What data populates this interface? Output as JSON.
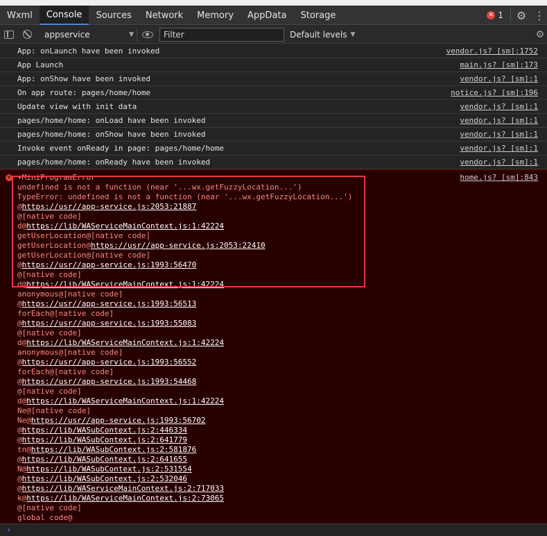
{
  "tabs": [
    {
      "label": "Wxml",
      "active": false
    },
    {
      "label": "Console",
      "active": true
    },
    {
      "label": "Sources",
      "active": false
    },
    {
      "label": "Network",
      "active": false
    },
    {
      "label": "Memory",
      "active": false
    },
    {
      "label": "AppData",
      "active": false
    },
    {
      "label": "Storage",
      "active": false
    }
  ],
  "error_count": "1",
  "toolbar": {
    "context": "appservice",
    "filter_placeholder": "Filter",
    "levels": "Default levels"
  },
  "logs": [
    {
      "text": "App: onLaunch have been invoked",
      "source": "vendor.js? [sm]:1752"
    },
    {
      "text": "App Launch",
      "source": "main.js? [sm]:173"
    },
    {
      "text": "App: onShow have been invoked",
      "source": "vendor.js? [sm]:1"
    },
    {
      "text": "On app route: pages/home/home",
      "source": "notice.js? [sm]:196"
    },
    {
      "text": "Update view with init data",
      "source": "vendor.js? [sm]:1"
    },
    {
      "text": "pages/home/home: onLoad have been invoked",
      "source": "vendor.js? [sm]:1"
    },
    {
      "text": "pages/home/home: onShow have been invoked",
      "source": "vendor.js? [sm]:1"
    },
    {
      "text": "Invoke event onReady in page: pages/home/home",
      "source": "vendor.js? [sm]:1"
    },
    {
      "text": "pages/home/home: onReady have been invoked",
      "source": "vendor.js? [sm]:1"
    }
  ],
  "error": {
    "source": "home.js? [sm]:843",
    "header": "▾MiniProgramError",
    "lines": [
      {
        "fn": "undefined is not a function (near '...wx.getFuzzyLocation...')",
        "url": ""
      },
      {
        "fn": "TypeError: undefined is not a function (near '...wx.getFuzzyLocation...')",
        "url": ""
      },
      {
        "fn": "@",
        "url": "https://usr//app-service.js:2053:21887"
      },
      {
        "fn": "@[native code]",
        "url": ""
      },
      {
        "fn": "d@",
        "url": "https://lib/WAServiceMainContext.js:1:42224"
      },
      {
        "fn": "getUserLocation@[native code]",
        "url": ""
      },
      {
        "fn": "getUserLocation@",
        "url": "https://usr//app-service.js:2053:22410"
      },
      {
        "fn": "getUserLocation@[native code]",
        "url": ""
      },
      {
        "fn": "@",
        "url": "https://usr//app-service.js:1993:56470"
      },
      {
        "fn": "@[native code]",
        "url": ""
      },
      {
        "fn": "d@",
        "url": "https://lib/WAServiceMainContext.js:1:42224"
      },
      {
        "fn": "anonymous@[native code]",
        "url": ""
      },
      {
        "fn": "@",
        "url": "https://usr//app-service.js:1993:56513"
      },
      {
        "fn": "forEach@[native code]",
        "url": ""
      },
      {
        "fn": "@",
        "url": "https://usr//app-service.js:1993:55083"
      },
      {
        "fn": "@[native code]",
        "url": ""
      },
      {
        "fn": "d@",
        "url": "https://lib/WAServiceMainContext.js:1:42224"
      },
      {
        "fn": "anonymous@[native code]",
        "url": ""
      },
      {
        "fn": "@",
        "url": "https://usr//app-service.js:1993:56552"
      },
      {
        "fn": "forEach@[native code]",
        "url": ""
      },
      {
        "fn": "@",
        "url": "https://usr//app-service.js:1993:54468"
      },
      {
        "fn": "@[native code]",
        "url": ""
      },
      {
        "fn": "d@",
        "url": "https://lib/WAServiceMainContext.js:1:42224"
      },
      {
        "fn": "Ne@[native code]",
        "url": ""
      },
      {
        "fn": "Ne@",
        "url": "https://usr//app-service.js:1993:56702"
      },
      {
        "fn": "@",
        "url": "https://lib/WASubContext.js:2:446334"
      },
      {
        "fn": "@",
        "url": "https://lib/WASubContext.js:2:641779"
      },
      {
        "fn": "tn@",
        "url": "https://lib/WASubContext.js:2:581876"
      },
      {
        "fn": "@",
        "url": "https://lib/WASubContext.js:2:641655"
      },
      {
        "fn": "N@",
        "url": "https://lib/WASubContext.js:2:531554"
      },
      {
        "fn": "@",
        "url": "https://lib/WASubContext.js:2:532046"
      },
      {
        "fn": "@",
        "url": "https://lib/WAServiceMainContext.js:2:717033"
      },
      {
        "fn": "k@",
        "url": "https://lib/WAServiceMainContext.js:2:73065"
      },
      {
        "fn": "@[native code]",
        "url": ""
      },
      {
        "fn": "global code@",
        "url": ""
      }
    ]
  },
  "colors": {
    "error_bg": "#290000",
    "error_text": "#f28b82",
    "highlight_border": "#e8393a",
    "accent": "#4d88d9"
  },
  "icons": {
    "sidebar": "sidebar-toggle-icon",
    "clear": "clear-console-icon",
    "eye": "live-expression-eye-icon",
    "settings": "gear-icon",
    "prompt": "chevron-right-icon"
  }
}
